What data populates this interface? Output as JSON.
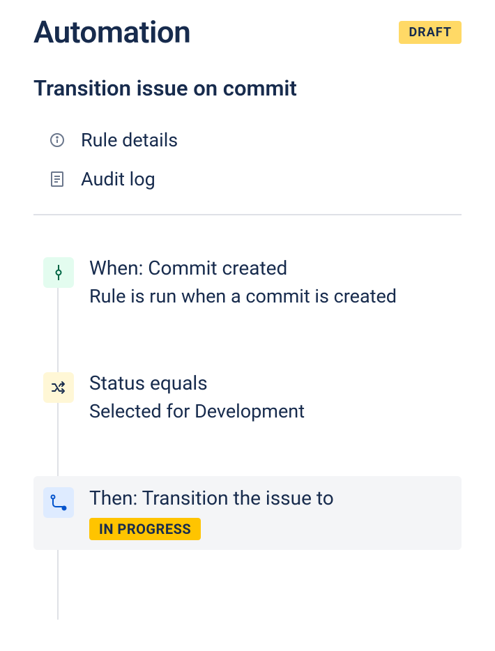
{
  "header": {
    "title": "Automation",
    "badge": "DRAFT"
  },
  "rule": {
    "name": "Transition issue on commit"
  },
  "meta": {
    "details": "Rule details",
    "audit": "Audit log"
  },
  "steps": {
    "trigger": {
      "title": "When: Commit created",
      "desc": "Rule is run when a commit is created"
    },
    "condition": {
      "title": "Status equals",
      "desc": "Selected for Development"
    },
    "action": {
      "title": "Then: Transition the issue to",
      "badge": "IN PROGRESS"
    }
  }
}
